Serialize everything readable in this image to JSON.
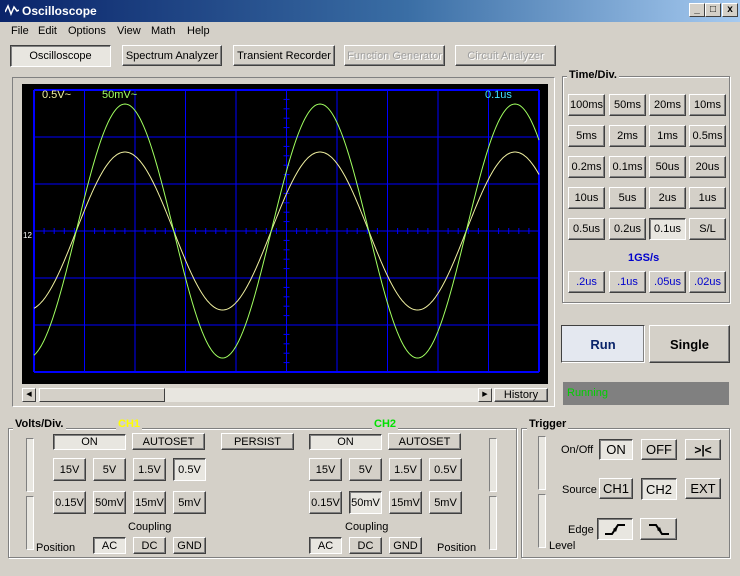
{
  "window": {
    "title": "Oscilloscope",
    "minimize": "_",
    "maximize": "□",
    "close": "x"
  },
  "menu": [
    "File",
    "Edit",
    "Options",
    "View",
    "Math",
    "Help"
  ],
  "modes": [
    {
      "label": "Oscilloscope",
      "state": "pressed"
    },
    {
      "label": "Spectrum Analyzer",
      "state": "normal"
    },
    {
      "label": "Transient Recorder",
      "state": "normal"
    },
    {
      "label": "Function Generator",
      "state": "disabled"
    },
    {
      "label": "Circuit Analyzer",
      "state": "disabled"
    }
  ],
  "screen": {
    "ch1_scale": "0.5V~",
    "ch2_scale": "50mV~",
    "timebase": "0.1us",
    "marker": "12",
    "colors": {
      "ch1": "#f0f0a0",
      "ch2": "#a0ff60",
      "grid": "#0000ff",
      "timebase": "#40e0ff"
    }
  },
  "history_label": "History",
  "timediv": {
    "title": "Time/Div.",
    "rows": [
      [
        "100ms",
        "50ms",
        "20ms",
        "10ms"
      ],
      [
        "5ms",
        "2ms",
        "1ms",
        "0.5ms"
      ],
      [
        "0.2ms",
        "0.1ms",
        "50us",
        "20us"
      ],
      [
        "10us",
        "5us",
        "2us",
        "1us"
      ],
      [
        "0.5us",
        "0.2us",
        "0.1us",
        "S/L"
      ]
    ],
    "selected": "0.1us",
    "sample_rate": "1GS/s",
    "fast": [
      ".2us",
      ".1us",
      ".05us",
      ".02us"
    ]
  },
  "run_label": "Run",
  "single_label": "Single",
  "status": "Running",
  "volts": {
    "title": "Volts/Div.",
    "ch1_title": "CH1",
    "ch2_title": "CH2",
    "on": "ON",
    "autoset": "AUTOSET",
    "persist": "PERSIST",
    "row1": [
      "15V",
      "5V",
      "1.5V",
      "0.5V"
    ],
    "row2": [
      "0.15V",
      "50mV",
      "15mV",
      "5mV"
    ],
    "ch1_selected": "0.5V",
    "ch2_selected": "50mV",
    "coupling": "Coupling",
    "coupling_opts": [
      "AC",
      "DC",
      "GND"
    ],
    "coupling_selected": "AC",
    "position": "Position",
    "ch1_color": "#ffff00",
    "ch2_color": "#00e000"
  },
  "trigger": {
    "title": "Trigger",
    "onoff_label": "On/Off",
    "on": "ON",
    "off": "OFF",
    "center": ">|<",
    "source_label": "Source",
    "sources": [
      "CH1",
      "CH2",
      "EXT"
    ],
    "source_selected": "CH2",
    "edge_label": "Edge",
    "level_label": "Level"
  }
}
